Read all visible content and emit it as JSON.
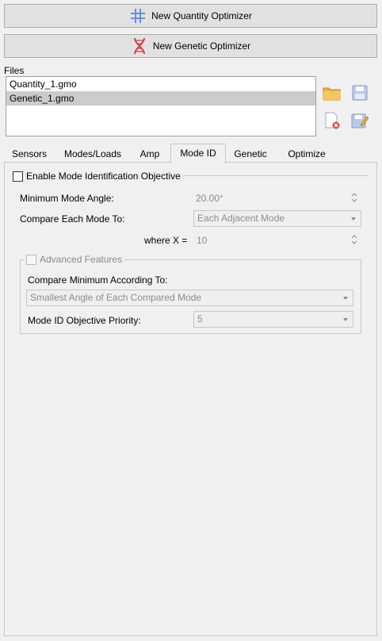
{
  "top_buttons": {
    "quantity_label": "New Quantity Optimizer",
    "genetic_label": "New Genetic Optimizer"
  },
  "files": {
    "label": "Files",
    "items": [
      "Quantity_1.gmo",
      "Genetic_1.gmo"
    ],
    "selected_index": 1
  },
  "tabs": [
    "Sensors",
    "Modes/Loads",
    "Amp",
    "Mode ID",
    "Genetic",
    "Optimize"
  ],
  "active_tab": "Mode ID",
  "mode_id": {
    "enable_label": "Enable Mode Identification Objective",
    "min_angle_label": "Minimum Mode Angle:",
    "min_angle_value": "20.00°",
    "compare_label": "Compare Each Mode To:",
    "compare_value": "Each Adjacent Mode",
    "where_label": "where X =",
    "where_value": "10",
    "advanced": {
      "label": "Advanced Features",
      "compare_min_label": "Compare Minimum According To:",
      "compare_min_value": "Smallest Angle of Each Compared Mode",
      "priority_label": "Mode ID Objective Priority:",
      "priority_value": "5"
    }
  },
  "colors": {
    "window_bg": "#f0f0f0",
    "selection": "#cccccc",
    "disabled_text": "#8c8c8c",
    "quantity_icon": "#6c8ed6",
    "genetic_icon": "#d04040"
  }
}
